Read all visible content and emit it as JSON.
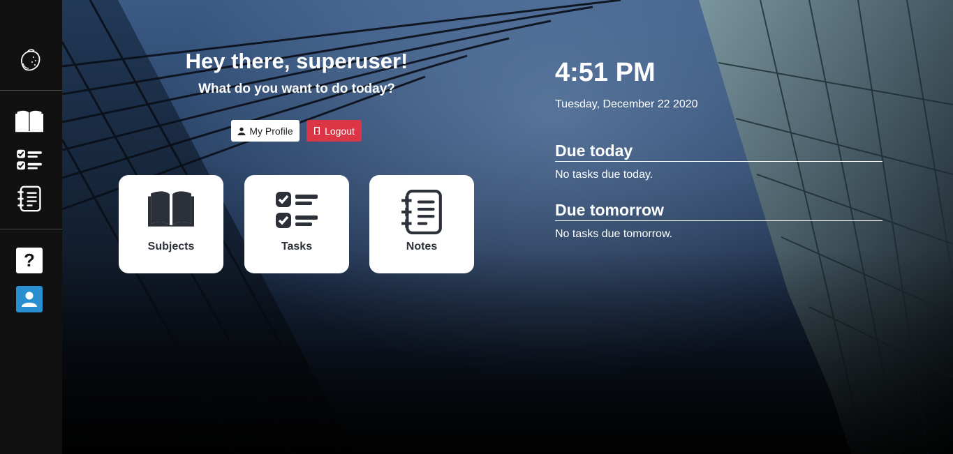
{
  "sidebar": {
    "logo": "lemon-icon",
    "nav": [
      {
        "icon": "book-icon",
        "name": "Subjects"
      },
      {
        "icon": "checklist-icon",
        "name": "Tasks"
      },
      {
        "icon": "notepad-icon",
        "name": "Notes"
      }
    ],
    "help_label": "?",
    "user_icon": "user-icon"
  },
  "header": {
    "greeting": "Hey there, superuser!",
    "subtitle": "What do you want to do today?",
    "profile_label": "My Profile",
    "logout_label": "Logout"
  },
  "cards": [
    {
      "label": "Subjects",
      "icon": "book-icon"
    },
    {
      "label": "Tasks",
      "icon": "checklist-icon"
    },
    {
      "label": "Notes",
      "icon": "notepad-icon"
    }
  ],
  "clock": {
    "time": "4:51 PM",
    "date": "Tuesday, December 22 2020"
  },
  "due": {
    "today_title": "Due today",
    "today_text": "No tasks due today.",
    "tomorrow_title": "Due tomorrow",
    "tomorrow_text": "No tasks due tomorrow."
  },
  "colors": {
    "sidebar": "#111111",
    "logout": "#dc3545",
    "user_badge": "#2a8fd0",
    "card_icon": "#2c3038"
  }
}
